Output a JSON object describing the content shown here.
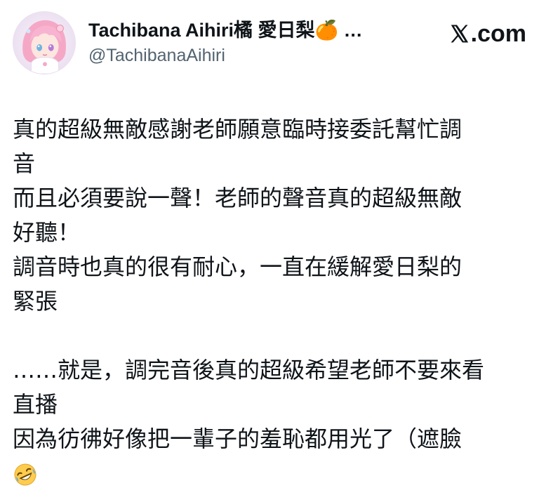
{
  "tweet": {
    "author": {
      "display_name": "Tachibana Aihiri橘 愛日梨🍊 …",
      "handle": "@TachibanaAihiri",
      "avatar_icon": "avatar-icon"
    },
    "brand": {
      "logo_icon": "x-logo-icon",
      "label": ".com"
    },
    "lines": [
      "真的超級無敵感謝老師願意臨時接委託幫忙調",
      "音",
      "而且必須要說一聲！老師的聲音真的超級無敵",
      "好聽！",
      "調音時也真的很有耐心，一直在緩解愛日梨的",
      "緊張",
      "",
      "……就是，調完音後真的超級希望老師不要來看",
      "直播",
      "因為彷彿好像把一輩子的羞恥都用光了（遮臉"
    ],
    "final_emoji": "rolling-on-floor-laughing-emoji",
    "colors": {
      "text": "#0f1419",
      "secondary": "#536471",
      "background": "#ffffff"
    }
  }
}
